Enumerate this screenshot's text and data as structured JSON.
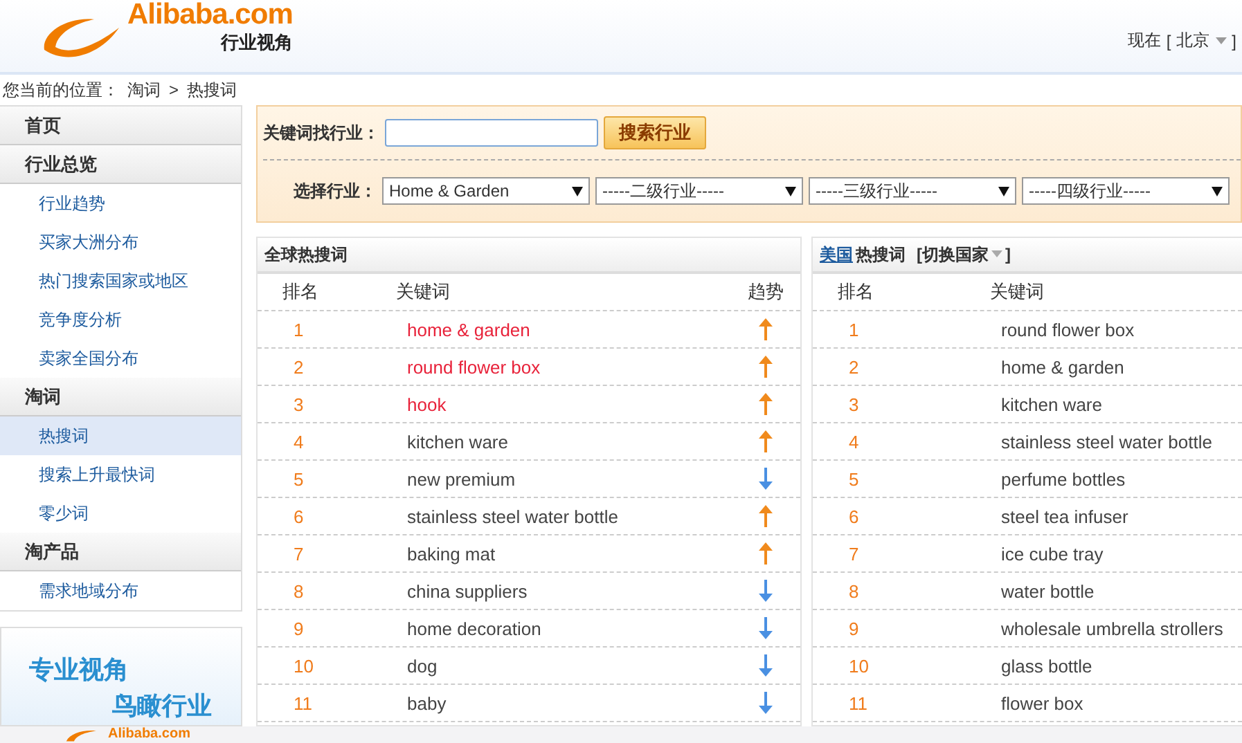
{
  "header": {
    "logo": "Alibaba.com",
    "subtitle": "行业视角",
    "location_label": "现在",
    "location_open": "[",
    "location": "北京",
    "location_close": "]"
  },
  "breadcrumb": {
    "label": "您当前的位置：",
    "items": [
      "淘词",
      "热搜词"
    ],
    "separator": ">"
  },
  "sidebar": {
    "sections": [
      {
        "title": "首页"
      },
      {
        "title": "行业总览",
        "items": [
          {
            "label": "行业趋势",
            "selected": false
          },
          {
            "label": "买家大洲分布",
            "selected": false
          },
          {
            "label": "热门搜索国家或地区",
            "selected": false
          },
          {
            "label": "竞争度分析",
            "selected": false
          },
          {
            "label": "卖家全国分布",
            "selected": false
          }
        ]
      },
      {
        "title": "淘词",
        "items": [
          {
            "label": "热搜词",
            "selected": true
          },
          {
            "label": "搜索上升最快词",
            "selected": false
          },
          {
            "label": "零少词",
            "selected": false
          }
        ]
      },
      {
        "title": "淘产品",
        "items": [
          {
            "label": "需求地域分布",
            "selected": false
          }
        ]
      }
    ]
  },
  "banner": {
    "line1": "专业视角",
    "line2": "鸟瞰行业"
  },
  "search": {
    "label": "关键词找行业：",
    "button": "搜索行业"
  },
  "filter": {
    "label": "选择行业：",
    "selects": [
      "Home & Garden",
      "-----二级行业-----",
      "-----三级行业-----",
      "-----四级行业-----"
    ]
  },
  "global_table": {
    "title": "全球热搜词",
    "columns": [
      "排名",
      "关键词",
      "趋势"
    ],
    "rows": [
      {
        "rank": "1",
        "keyword": "home & garden",
        "highlighted": true,
        "rising": true
      },
      {
        "rank": "2",
        "keyword": "round flower box",
        "highlighted": true,
        "rising": true
      },
      {
        "rank": "3",
        "keyword": "hook",
        "highlighted": true,
        "rising": true
      },
      {
        "rank": "4",
        "keyword": "kitchen ware",
        "highlighted": false,
        "rising": true
      },
      {
        "rank": "5",
        "keyword": "new premium",
        "highlighted": false,
        "rising": false
      },
      {
        "rank": "6",
        "keyword": "stainless steel water bottle",
        "highlighted": false,
        "rising": true
      },
      {
        "rank": "7",
        "keyword": "baking mat",
        "highlighted": false,
        "rising": true
      },
      {
        "rank": "8",
        "keyword": "china suppliers",
        "highlighted": false,
        "rising": false
      },
      {
        "rank": "9",
        "keyword": "home decoration",
        "highlighted": false,
        "rising": false
      },
      {
        "rank": "10",
        "keyword": "dog",
        "highlighted": false,
        "rising": false
      },
      {
        "rank": "11",
        "keyword": "baby",
        "highlighted": false,
        "rising": false
      }
    ]
  },
  "country_table": {
    "country": "美国",
    "title": "热搜词",
    "switch": "[切换国家",
    "switch_end": "]",
    "columns": [
      "排名",
      "关键词"
    ],
    "rows": [
      {
        "rank": "1",
        "keyword": "round flower box"
      },
      {
        "rank": "2",
        "keyword": "home & garden"
      },
      {
        "rank": "3",
        "keyword": "kitchen ware"
      },
      {
        "rank": "4",
        "keyword": "stainless steel water bottle"
      },
      {
        "rank": "5",
        "keyword": "perfume bottles"
      },
      {
        "rank": "6",
        "keyword": "steel tea infuser"
      },
      {
        "rank": "7",
        "keyword": "ice cube tray"
      },
      {
        "rank": "8",
        "keyword": "water bottle"
      },
      {
        "rank": "9",
        "keyword": "wholesale umbrella strollers"
      },
      {
        "rank": "10",
        "keyword": "glass bottle"
      },
      {
        "rank": "11",
        "keyword": "flower box"
      }
    ]
  },
  "footer": {
    "logo": "Alibaba.com"
  }
}
